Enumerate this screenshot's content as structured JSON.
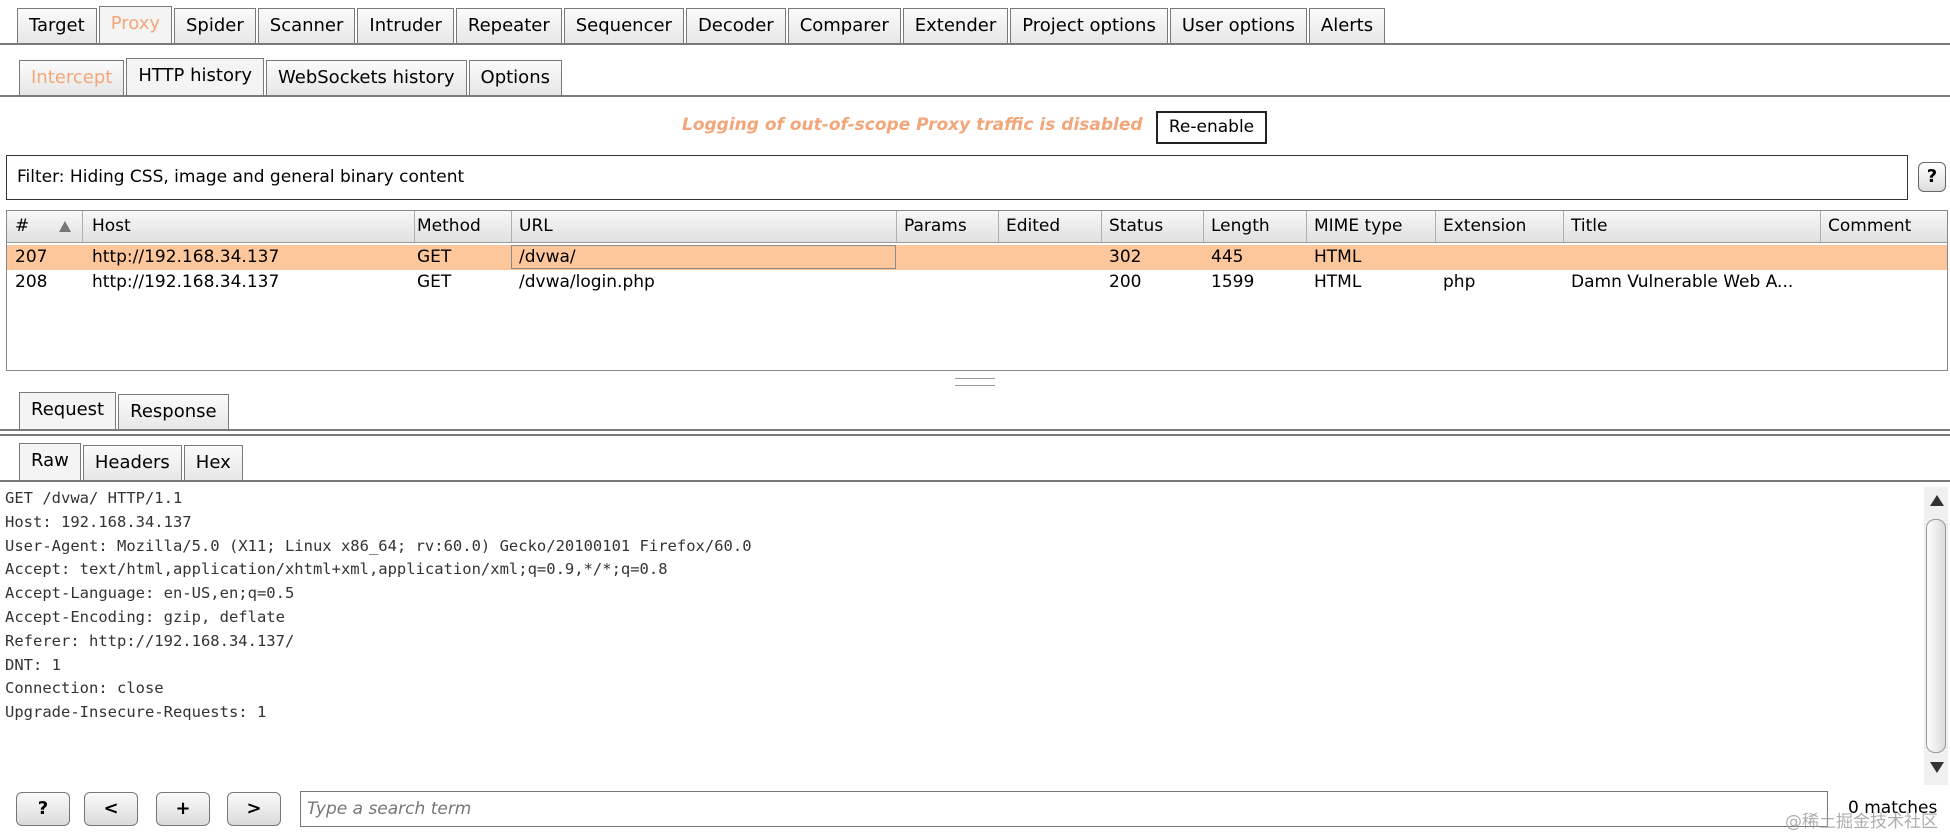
{
  "main_tabs": {
    "items": [
      "Target",
      "Proxy",
      "Spider",
      "Scanner",
      "Intruder",
      "Repeater",
      "Sequencer",
      "Decoder",
      "Comparer",
      "Extender",
      "Project options",
      "User options",
      "Alerts"
    ]
  },
  "proxy_tabs": {
    "items": [
      "Intercept",
      "HTTP history",
      "WebSockets history",
      "Options"
    ]
  },
  "scope": {
    "message": "Logging of out-of-scope Proxy traffic is disabled",
    "button": "Re-enable"
  },
  "filter": {
    "text": "Filter: Hiding CSS, image and general binary content",
    "help": "?"
  },
  "history_table": {
    "columns": [
      "#",
      "Host",
      "Method",
      "URL",
      "Params",
      "Edited",
      "Status",
      "Length",
      "MIME type",
      "Extension",
      "Title",
      "Comment"
    ],
    "rows": [
      [
        "207",
        "http://192.168.34.137",
        "GET",
        "/dvwa/",
        "",
        "",
        "302",
        "445",
        "HTML",
        "",
        "",
        ""
      ],
      [
        "208",
        "http://192.168.34.137",
        "GET",
        "/dvwa/login.php",
        "",
        "",
        "200",
        "1599",
        "HTML",
        "php",
        "Damn Vulnerable Web A...",
        ""
      ]
    ]
  },
  "message_tabs": {
    "items": [
      "Request",
      "Response"
    ]
  },
  "view_tabs": {
    "items": [
      "Raw",
      "Headers",
      "Hex"
    ]
  },
  "raw_request": {
    "lines": [
      "GET /dvwa/ HTTP/1.1",
      "Host: 192.168.34.137",
      "User-Agent: Mozilla/5.0 (X11; Linux x86_64; rv:60.0) Gecko/20100101 Firefox/60.0",
      "Accept: text/html,application/xhtml+xml,application/xml;q=0.9,*/*;q=0.8",
      "Accept-Language: en-US,en;q=0.5",
      "Accept-Encoding: gzip, deflate",
      "Referer: http://192.168.34.137/",
      "DNT: 1",
      "Connection: close",
      "Upgrade-Insecure-Requests: 1"
    ]
  },
  "search": {
    "help": "?",
    "prev": "<",
    "add": "+",
    "next": ">",
    "placeholder": "Type a search term",
    "matches": "0 matches"
  },
  "watermark": "@稀土掘金技术社区",
  "colors": {
    "accent_orange": "#f3a679",
    "selected_row": "#fdc69b"
  }
}
